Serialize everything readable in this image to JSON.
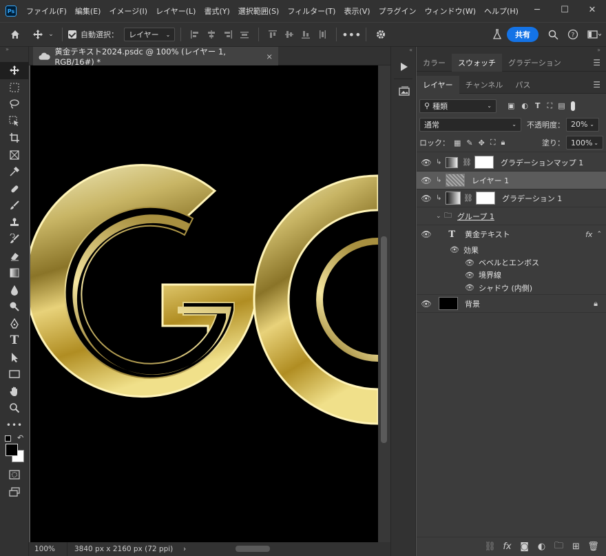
{
  "app": {
    "logo": "Ps"
  },
  "menu": [
    "ファイル(F)",
    "編集(E)",
    "イメージ(I)",
    "レイヤー(L)",
    "書式(Y)",
    "選択範囲(S)",
    "フィルター(T)",
    "表示(V)",
    "プラグイン",
    "ウィンドウ(W)",
    "ヘルプ(H)"
  ],
  "window_buttons": {
    "minimize": "─",
    "maximize": "☐",
    "close": "✕"
  },
  "options": {
    "auto_select_label": "自動選択：",
    "auto_select_target": "レイヤー",
    "share_label": "共有"
  },
  "document": {
    "tab_title": "黄金テキスト2024.psdc @ 100% (レイヤー 1, RGB/16#) *",
    "close": "×"
  },
  "status": {
    "zoom": "100%",
    "info": "3840 px x 2160 px (72 ppi)",
    "arrow": "›"
  },
  "panel_top_tabs": [
    "カラー",
    "スウォッチ",
    "グラデーション"
  ],
  "layers_tabs": [
    "レイヤー",
    "チャンネル",
    "パス"
  ],
  "layers_panel": {
    "filter_label": "種類",
    "blend_mode": "通常",
    "opacity_label": "不透明度：",
    "opacity_value": "20%",
    "lock_label": "ロック：",
    "fill_label": "塗り：",
    "fill_value": "100%"
  },
  "layers": [
    {
      "name": "グラデーションマップ 1"
    },
    {
      "name": "レイヤー 1"
    },
    {
      "name": "グラデーション 1"
    },
    {
      "name": "グループ 1"
    },
    {
      "name": "黄金テキスト",
      "fx": "fx"
    },
    {
      "name": "効果"
    },
    {
      "name": "ベベルとエンボス"
    },
    {
      "name": "境界線"
    },
    {
      "name": "シャドウ (内側)"
    },
    {
      "name": "背景"
    }
  ],
  "canvas_text": "GO",
  "colors": {
    "accent": "#1473e6",
    "chrome": "#323232",
    "canvas": "#000000",
    "gold": "#d4c070"
  }
}
